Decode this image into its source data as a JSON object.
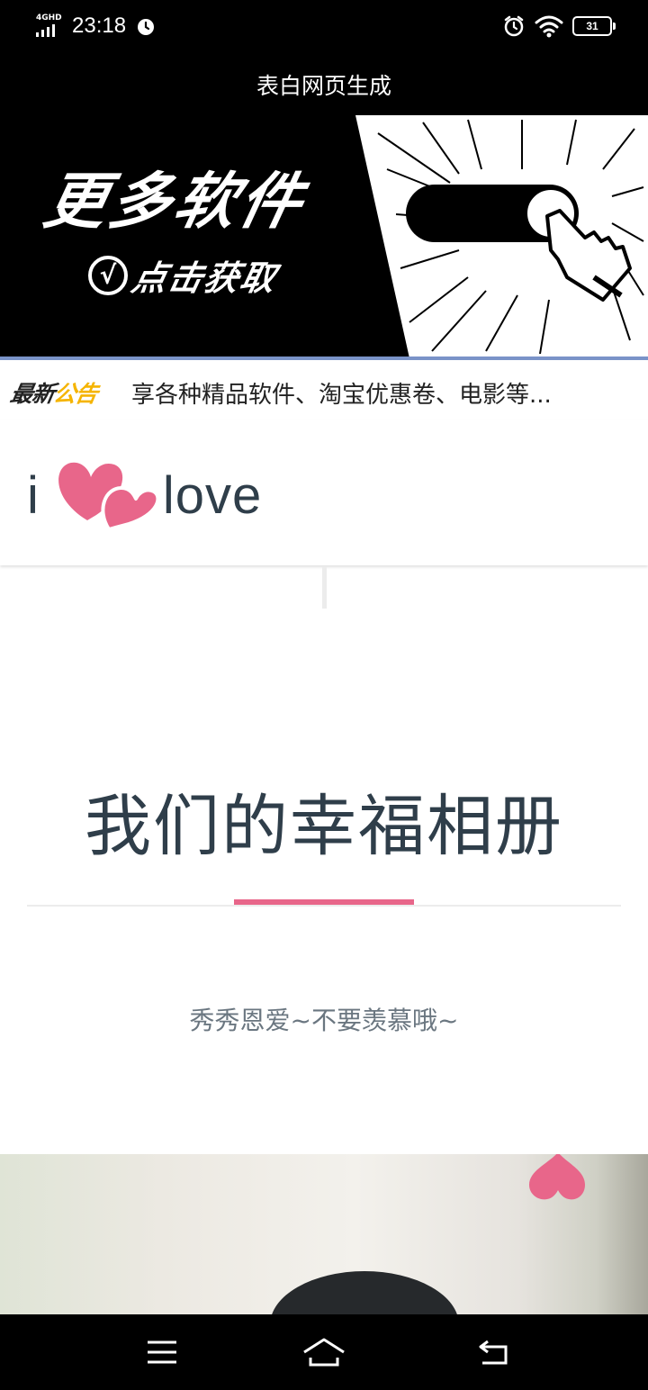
{
  "status_bar": {
    "network": "4GHD",
    "time": "23:18",
    "battery": "31",
    "icons": [
      "signal-icon",
      "alarm-icon",
      "wifi-icon",
      "battery-icon"
    ]
  },
  "app_title": "表白网页生成",
  "banner": {
    "main_text": "更多软件",
    "cta_text": "点击获取",
    "check_glyph": "√"
  },
  "notice": {
    "badge_part1": "最新",
    "badge_part2": "公告",
    "text": "享各种精品软件、淘宝优惠卷、电影等..."
  },
  "logo": {
    "prefix": "i",
    "suffix": "love",
    "heart_color": "#e8668a"
  },
  "section": {
    "title": "我们的幸福相册",
    "subtitle": "秀秀恩爱~不要羡慕哦~",
    "accent_color": "#e8668a"
  },
  "nav_bar": {
    "icons": [
      "menu-icon",
      "home-icon",
      "back-icon"
    ]
  }
}
